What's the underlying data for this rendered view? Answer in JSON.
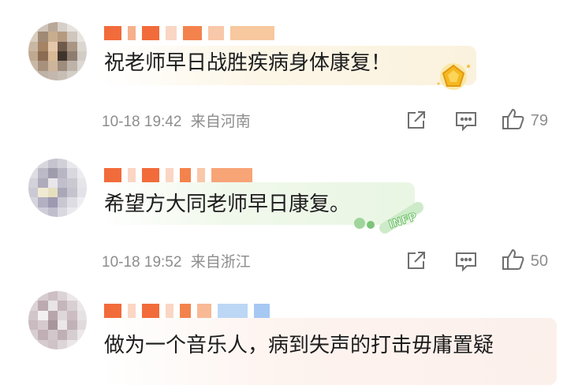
{
  "comments": [
    {
      "text": "祝老师早日战胜疾病身体康复！",
      "time": "10-18 19:42",
      "location": "来自河南",
      "likes": "79",
      "badge_icon": "gold-medal-icon",
      "bubble_color": "#fbf1de"
    },
    {
      "text": "希望方大同老师早日康复。",
      "time": "10-18 19:52",
      "location": "来自浙江",
      "likes": "50",
      "badge_text": "INFP",
      "badge_icon": "infp-badge-icon",
      "bubble_color": "#e9f5e3"
    },
    {
      "text": "做为一个音乐人，病到失声的打击毋庸置疑",
      "bubble_color": "#fcefe9"
    }
  ],
  "icons": {
    "share": "share-icon",
    "comment": "comment-icon",
    "like": "thumbs-up-icon"
  },
  "colors": {
    "meta_text": "#8d8d8d",
    "body_text": "#1d1d1d"
  }
}
